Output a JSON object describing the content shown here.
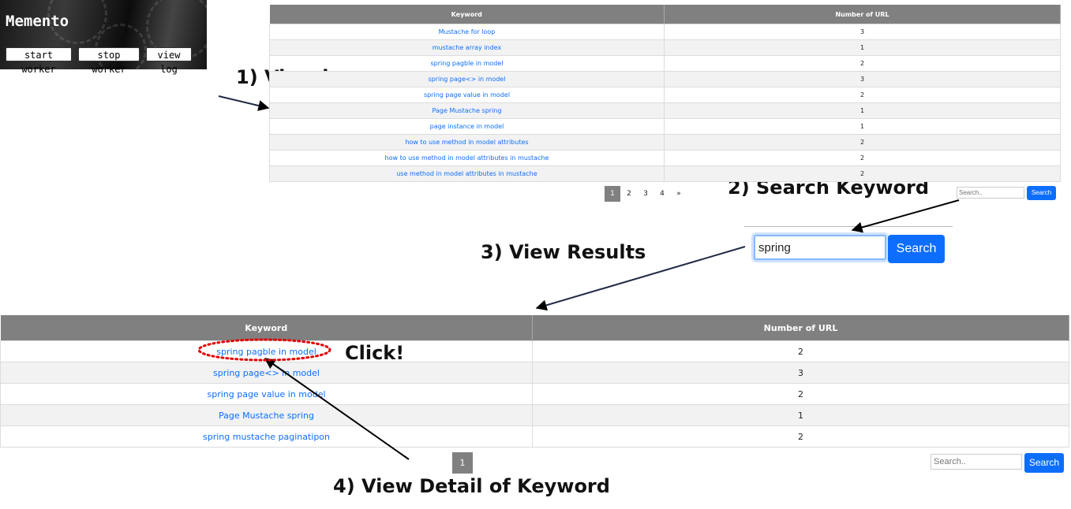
{
  "memento": {
    "title": "Memento",
    "buttons": [
      "start worker",
      "stop worker",
      "view log"
    ]
  },
  "steps": {
    "view_log": "1) View log",
    "search_keyword": "2) Search Keyword",
    "view_results": "3) View Results",
    "view_detail": "4) View Detail of Keyword",
    "click": "Click!"
  },
  "log_table": {
    "headers": [
      "Keyword",
      "Number of URL"
    ],
    "rows": [
      [
        "Mustache for loop",
        "3"
      ],
      [
        "mustache array index",
        "1"
      ],
      [
        "spring pagble in model",
        "2"
      ],
      [
        "spring page<> in model",
        "3"
      ],
      [
        "spring page value in model",
        "2"
      ],
      [
        "Page Mustache spring",
        "1"
      ],
      [
        "page instance in model",
        "1"
      ],
      [
        "how to use method in model attributes",
        "2"
      ],
      [
        "how to use method in model attributes in mustache",
        "2"
      ],
      [
        "use method in model attributes in mustache",
        "2"
      ]
    ],
    "pagination": [
      "1",
      "2",
      "3",
      "4",
      "»"
    ],
    "search_placeholder": "Search..",
    "search_button": "Search"
  },
  "zoom_search": {
    "value": "spring",
    "button": "Search"
  },
  "results_table": {
    "headers": [
      "Keyword",
      "Number of URL"
    ],
    "rows": [
      [
        "spring pagble in model",
        "2"
      ],
      [
        "spring page<> in model",
        "3"
      ],
      [
        "spring page value in model",
        "2"
      ],
      [
        "Page Mustache spring",
        "1"
      ],
      [
        "spring mustache paginatipon",
        "2"
      ]
    ],
    "pagination": [
      "1"
    ],
    "search_placeholder": "Search..",
    "search_button": "Search"
  },
  "colors": {
    "accent": "#0d6efd",
    "header": "#808080",
    "highlight": "#e00000"
  }
}
